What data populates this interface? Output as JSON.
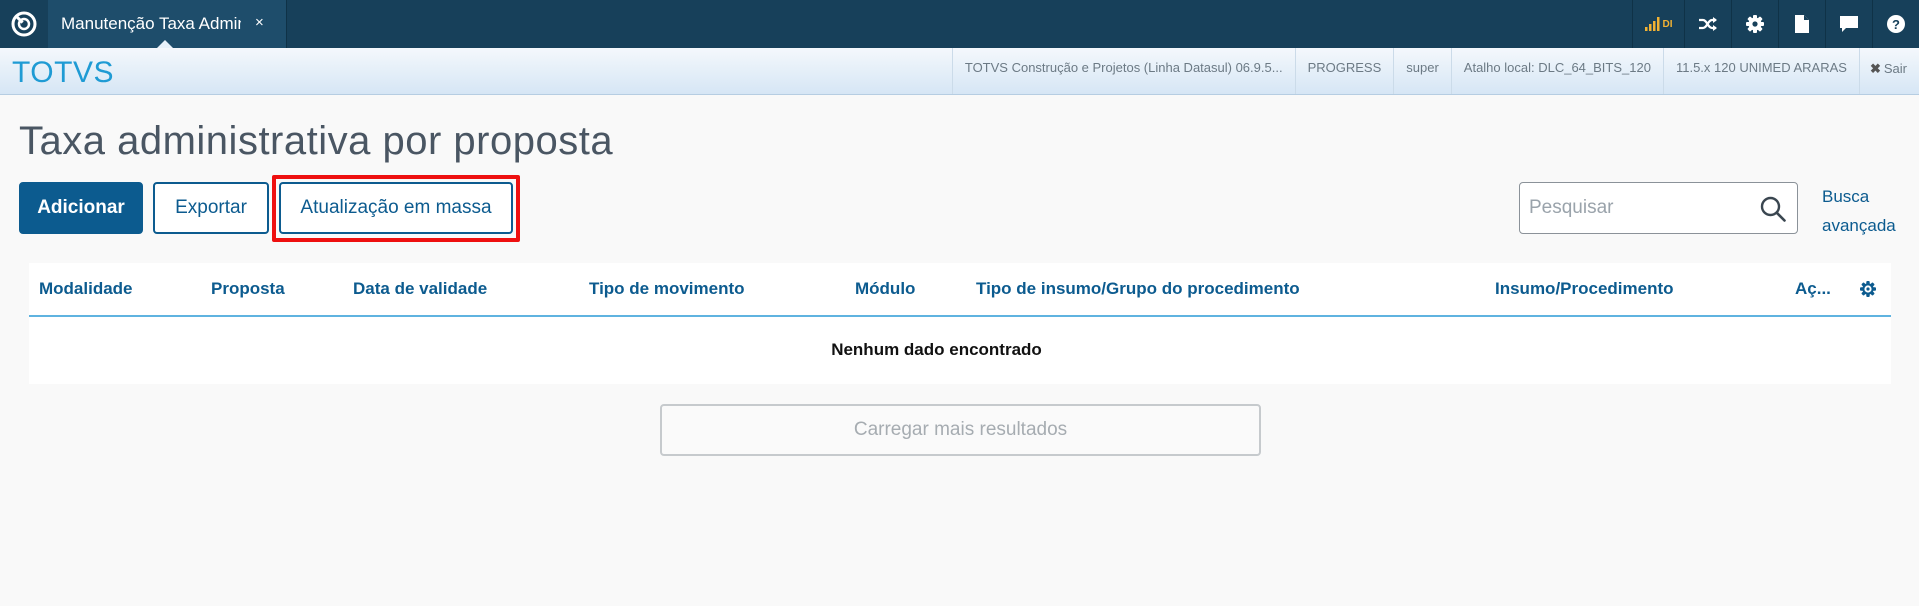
{
  "topbar": {
    "tab_label": "Manutenção Taxa Administrativa",
    "tab_close": "×",
    "signal_label": "DI"
  },
  "header": {
    "brand": "TOTVS",
    "info": [
      "TOTVS Construção e Projetos (Linha Datasul) 06.9.5...",
      "PROGRESS",
      "super",
      "Atalho local: DLC_64_BITS_120",
      "11.5.x 120 UNIMED ARARAS"
    ],
    "exit_label": "Sair"
  },
  "page": {
    "title": "Taxa administrativa por proposta"
  },
  "toolbar": {
    "add_label": "Adicionar",
    "export_label": "Exportar",
    "mass_update_label": "Atualização em massa"
  },
  "search": {
    "placeholder": "Pesquisar",
    "advanced_line1": "Busca",
    "advanced_line2": "avançada"
  },
  "table": {
    "columns": [
      "Modalidade",
      "Proposta",
      "Data de validade",
      "Tipo de movimento",
      "Módulo",
      "Tipo de insumo/Grupo do procedimento",
      "Insumo/Procedimento",
      "Aç..."
    ],
    "empty_message": "Nenhum dado encontrado"
  },
  "load_more_label": "Carregar mais resultados",
  "colors": {
    "topbar": "#17405a",
    "primary": "#0c5b8f",
    "brand": "#1f9bd4",
    "highlight": "#ee1010",
    "signal": "#f2b233"
  },
  "icons": [
    "app-logo-icon",
    "signal-icon",
    "shuffle-icon",
    "gear-icon",
    "document-icon",
    "chat-icon",
    "help-icon",
    "search-icon",
    "settings-gear-icon",
    "close-icon"
  ]
}
